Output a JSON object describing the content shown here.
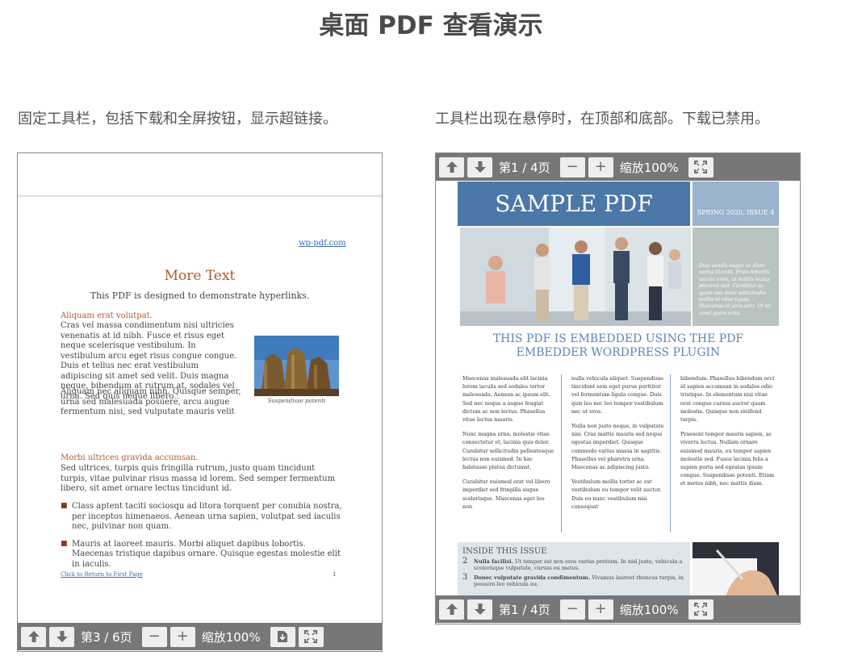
{
  "page": {
    "title": "桌面 PDF 查看演示",
    "left_description": "固定工具栏，包括下载和全屏按钮，显示超链接。",
    "right_description": "工具栏出现在悬停时，在顶部和底部。下载已禁用。"
  },
  "left_viewer": {
    "toolbar": {
      "page_label": "第3 / 6页",
      "zoom_label": "缩放100%",
      "icons": [
        "arrow-up-icon",
        "arrow-down-icon",
        "minus-icon",
        "plus-icon",
        "download-icon",
        "fullscreen-icon"
      ]
    },
    "pdf": {
      "link_top": "wp-pdf.com",
      "heading": "More Text",
      "subheading": "This PDF is designed to demonstrate hyperlinks.",
      "section1_title": "Aliquam erat volutpat.",
      "para1": "Cras vel massa condimentum nisi ultricies venenatis at id nibh. Fusce et risus eget neque scelerisque vestibulum. In vestibulum arcu eget risus congue congue. Duis et tellus nec erat vestibulum adipiscing sit amet sed velit. Duis magna neque, bibendum at rutrum at, sodales vel urna. Sed quis neque libero..",
      "para2": "Aliquam nec aliquam nibh. Quisque semper, urna sed malesuada posuere, arcu augue fermentum nisi, sed vulputate mauris velit id neque. Donec dignissim, dui eu rutrum scelerisque, erat ligula sodales nisi, eget viverra nibh odio sit amet elit. Sed sollicitudin felis vel turpis interdum dapibus. Proin ut lorem nunc, sit amet suscipit nisl. Duis eu nulla sapien. Vestibulum vel velit ac tellus placerat tempor.",
      "image_caption": "Suspendisse potenti",
      "section2_title": "Morbi ultrices gravida accumsan.",
      "para3": "Sed ultrices, turpis quis fringilla rutrum, justo quam tincidunt turpis, vitae pulvinar risus massa id lorem. Sed semper fermentum libero, sit amet ornare lectus tincidunt id.",
      "bullets": [
        "Class aptent taciti sociosqu ad litora torquent per conubia nostra, per inceptos himenaeos. Aenean urna sapien, volutpat sed iaculis nec, pulvinar non quam.",
        "Mauris at laoreet mauris. Morbi aliquet dapibus lobortis. Maecenas tristique dapibus ornare. Quisque egestas molestie elit in iaculis."
      ],
      "footer_link": "Click to Return to First Page",
      "page_number": "1"
    }
  },
  "right_viewer": {
    "toolbar_top": {
      "page_label": "第1 / 4页",
      "zoom_label": "缩放100%"
    },
    "toolbar_bottom": {
      "page_label": "第1 / 4页",
      "zoom_label": "缩放100%"
    },
    "pdf": {
      "banner_title": "SAMPLE PDF",
      "issue": "SPRING 2020, ISSUE 4",
      "side_quote": "Duis iaculis augue ac diam varius blandit. Proin lobortis iaculis enim, ut mattis lectus placerat sed. Curabitur ac quam nec dolor sollicitudin mollis id vitae ligula. Maecenas et arcu sem. Ut sit amet quam urna.",
      "headline": "THIS PDF IS EMBEDDED USING THE PDF EMBEDDER WORDPRESS PLUGIN",
      "col1": [
        "Maecenas malesuada elit lacinia lorem iaculis sed sodales tortor malesuada. Aenean ac ipsum elit. Sed nec neque a augue feugiat dictum ac non lectus. Phasellus vitae lectus mauris.",
        "Nunc magna urna, molestie vitae consectetur et, lacinia quis dolor. Curabitur sollicitudin pellentesque lectus non euismod. In hac habitasse platea dictumst.",
        "Curabitur euismod erat vel libero imperdiet sed fringilla augue scelerisque. Maecenas eget leo non"
      ],
      "col2": [
        "nulla vehicula aliquet. Suspendisse tincidunt sem eget purus porttitor vel fermentum ligula congue. Duis quis leo nec leo tempor vestibulum nec ut eros.",
        "Nulla non justo neque, in vulputate nisi. Cras mattis mauris sed neque egestas imperdiet. Quisque commodo varius massa in sagittis. Phasellus vel pharetra urna. Maecenas ac adipiscing justo.",
        "Vestibulum mollis tortor ac est vestibulum eu tempor velit auctor. Duis eu nunc vestibulum nisi consequat"
      ],
      "col3": [
        "bibendum. Phasellus bibendum orci id sapien accumsan in sodales odio tristique. In elementum nisi vitae erat congue cursus auctor quam molestie. Quisque non eleifend turpis.",
        "Praesent tempor mauris sapien, ac viverra lectus. Nullam ornare euismod mauris, eu tempor sapien molestie sed. Fusce lacinia felis a sapien porta sed egestas ipsum congue. Suspendisse potenti. Etiam et metus nibh, nec mattis diam."
      ],
      "inside_title": "INSIDE THIS ISSUE",
      "inside_items": [
        {
          "num": "2",
          "bold": "Nulla facilisi.",
          "rest": "Ut tempor est non eros varius pretium. In nisl justo, vehicula a scelerisque vulputate, cursus eu metus."
        },
        {
          "num": "3",
          "bold": "Donec vulputate gravida condimentum.",
          "rest": "Vivamus laoreet rhoncus turpis, in posuere leo vehicula eu."
        }
      ]
    }
  }
}
